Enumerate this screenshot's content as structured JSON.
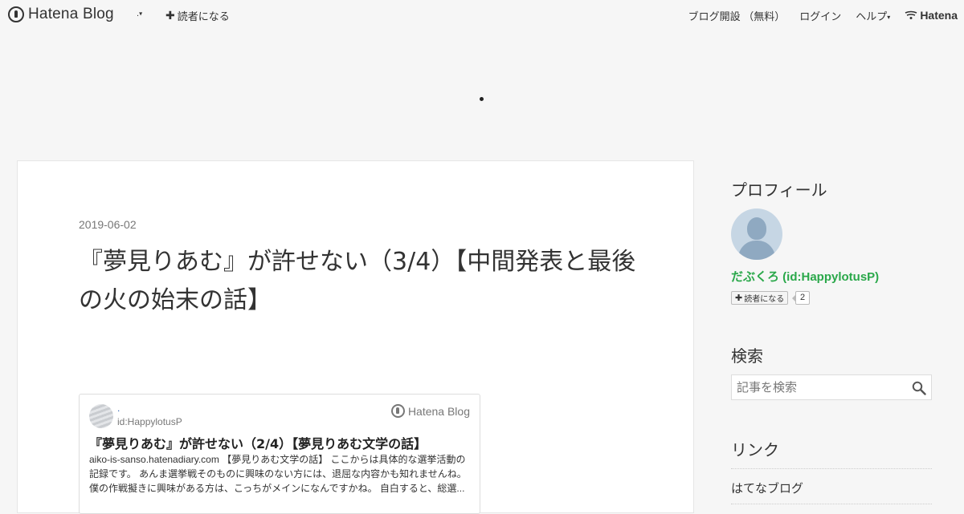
{
  "topbar": {
    "brand": "Hatena Blog",
    "blog_menu": ".",
    "subscribe_label": "読者になる",
    "signup_label": "ブログ開設 （無料）",
    "login_label": "ログイン",
    "help_label": "ヘルプ",
    "hatena_label": "Hatena"
  },
  "header": {
    "blog_title": ""
  },
  "entry": {
    "date": "2019-06-02",
    "title": "『夢見りあむ』が許せない（3/4）【中間発表と最後の火の始末の話】",
    "embed": {
      "blog_name": ".",
      "user_id": "id:HappylotusP",
      "brand": "Hatena Blog",
      "title": "『夢見りあむ』が許せない（2/4）【夢見りあむ文学の話】",
      "description": "aiko-is-sanso.hatenadiary.com 【夢見りあむ文学の話】 ここからは具体的な選挙活動の記録です。 あんま選挙戦そのものに興味のない方には、退屈な内容かも知れませんね。 僕の作戦擬きに興味がある方は、こっちがメインになんですかね。 自白すると、総選..."
    }
  },
  "sidebar": {
    "profile": {
      "title": "プロフィール",
      "name": "だぶくろ (id:HappylotusP)",
      "subscribe_label": "読者になる",
      "subscriber_count": "2"
    },
    "search": {
      "title": "検索",
      "placeholder": "記事を検索"
    },
    "links": {
      "title": "リンク",
      "items": [
        "はてなブログ"
      ]
    }
  }
}
